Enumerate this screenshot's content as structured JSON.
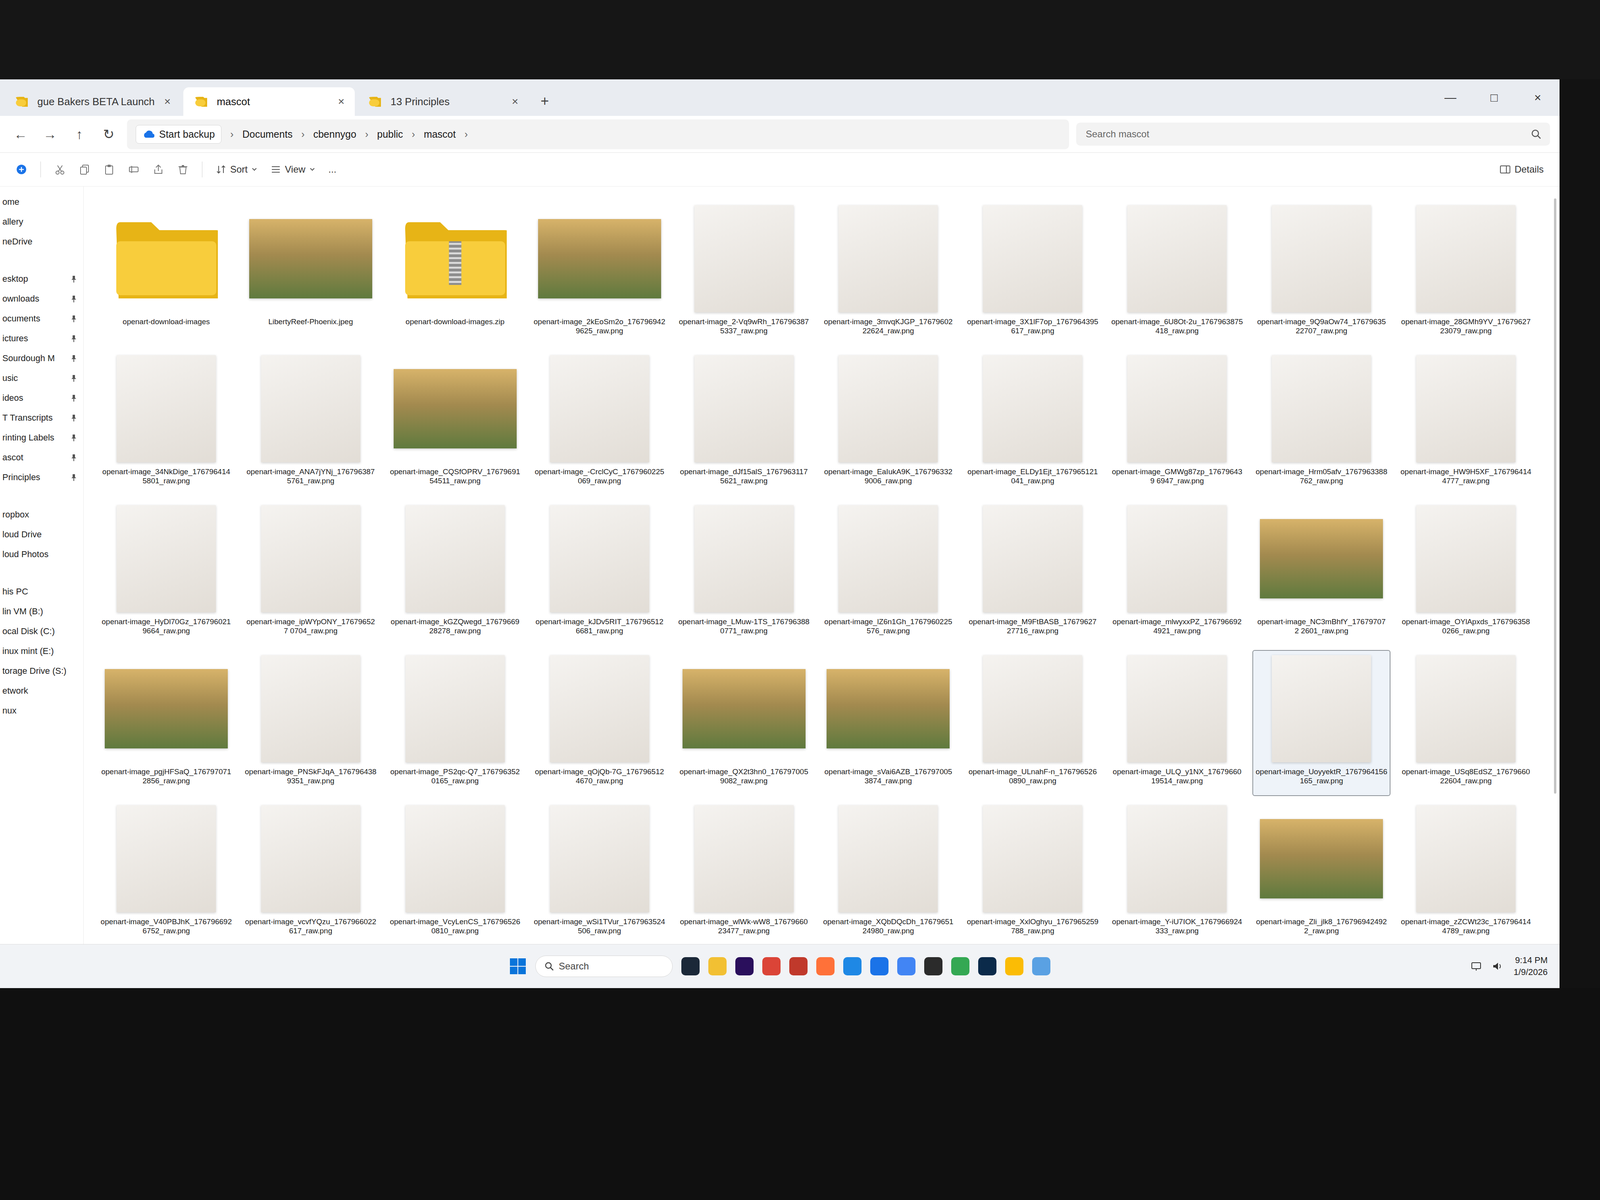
{
  "window": {
    "controls": [
      "—",
      "□",
      "×"
    ]
  },
  "tabs": [
    {
      "label": "gue Bakers BETA Launch",
      "selected": false,
      "close": "×"
    },
    {
      "label": "mascot",
      "selected": true,
      "close": "×"
    },
    {
      "label": "13 Principles",
      "selected": false,
      "close": "×"
    }
  ],
  "new_tab": "+",
  "nav": [
    "←",
    "→",
    "↑",
    "↻"
  ],
  "address": {
    "backup": "Start backup",
    "separator": "›",
    "crumbs": [
      "Documents",
      "cbennygo",
      "public",
      "mascot"
    ]
  },
  "search": {
    "placeholder": "Search mascot"
  },
  "toolbar": {
    "sort": "Sort",
    "view": "View",
    "more": "...",
    "details": "Details"
  },
  "sidebar": {
    "items": [
      {
        "label": "ome",
        "pinned": false
      },
      {
        "label": "allery",
        "pinned": false
      },
      {
        "label": "neDrive",
        "pinned": false
      },
      {
        "label": "esktop",
        "pinned": true
      },
      {
        "label": "ownloads",
        "pinned": true
      },
      {
        "label": "ocuments",
        "pinned": true
      },
      {
        "label": "ictures",
        "pinned": true
      },
      {
        "label": "Sourdough M",
        "pinned": true
      },
      {
        "label": "usic",
        "pinned": true
      },
      {
        "label": "ideos",
        "pinned": true
      },
      {
        "label": "T Transcripts",
        "pinned": true
      },
      {
        "label": "rinting Labels",
        "pinned": true
      },
      {
        "label": "ascot",
        "pinned": true
      },
      {
        "label": "Principles",
        "pinned": true
      },
      {
        "label": "ropbox",
        "pinned": false
      },
      {
        "label": "loud Drive",
        "pinned": false
      },
      {
        "label": "loud Photos",
        "pinned": false
      },
      {
        "label": "his PC",
        "pinned": false
      },
      {
        "label": "lin VM (B:)",
        "pinned": false
      },
      {
        "label": "ocal Disk (C:)",
        "pinned": false
      },
      {
        "label": "inux mint (E:)",
        "pinned": false
      },
      {
        "label": "torage Drive (S:)",
        "pinned": false
      },
      {
        "label": "etwork",
        "pinned": false
      },
      {
        "label": "nux",
        "pinned": false
      }
    ]
  },
  "files": [
    {
      "name": "openart-download-images",
      "kind": "folder",
      "selected": false
    },
    {
      "name": "LibertyReef-Phoenix.jpeg",
      "kind": "scene",
      "selected": false
    },
    {
      "name": "openart-download-images.zip",
      "kind": "zip",
      "selected": false
    },
    {
      "name": "openart-image_2kEoSm2o_1767969429625_raw.png",
      "kind": "scene",
      "selected": false
    },
    {
      "name": "openart-image_2-Vq9wRh_1767963875337_raw.png",
      "kind": "image",
      "selected": false
    },
    {
      "name": "openart-image_3mvqKJGP_1767960222624_raw.png",
      "kind": "image",
      "selected": false
    },
    {
      "name": "openart-image_3X1lF7op_1767964395617_raw.png",
      "kind": "image",
      "selected": false
    },
    {
      "name": "openart-image_6U8Ot-2u_1767963875418_raw.png",
      "kind": "image",
      "selected": false
    },
    {
      "name": "openart-image_9Q9aOw74_1767963522707_raw.png",
      "kind": "image",
      "selected": false
    },
    {
      "name": "openart-image_28GMh9YV_1767962723079_raw.png",
      "kind": "image",
      "selected": false
    },
    {
      "name": "openart-image_34NkDige_1767964145801_raw.png",
      "kind": "image",
      "selected": false
    },
    {
      "name": "openart-image_ANA7jYNj_1767963875761_raw.png",
      "kind": "image",
      "selected": false
    },
    {
      "name": "openart-image_CQSfOPRV_1767969154511_raw.png",
      "kind": "scene",
      "selected": false
    },
    {
      "name": "openart-image_-CrclCyC_1767960225069_raw.png",
      "kind": "image",
      "selected": false
    },
    {
      "name": "openart-image_dJf15alS_17679631175621_raw.png",
      "kind": "image",
      "selected": false
    },
    {
      "name": "openart-image_EaIukA9K_1767963329006_raw.png",
      "kind": "image",
      "selected": false
    },
    {
      "name": "openart-image_ELDy1Ejt_1767965121041_raw.png",
      "kind": "image",
      "selected": false
    },
    {
      "name": "openart-image_GMWg87zp_176796439 6947_raw.png",
      "kind": "image",
      "selected": false
    },
    {
      "name": "openart-image_Hrm05afv_1767963388762_raw.png",
      "kind": "image",
      "selected": false
    },
    {
      "name": "openart-image_HW9H5XF_1767964144777_raw.png",
      "kind": "image",
      "selected": false
    },
    {
      "name": "openart-image_HyDl70Gz_1767960219664_raw.png",
      "kind": "image",
      "selected": false
    },
    {
      "name": "openart-image_ipWYpONY_176796527 0704_raw.png",
      "kind": "image",
      "selected": false
    },
    {
      "name": "openart-image_kGZQwegd_1767966928278_raw.png",
      "kind": "image",
      "selected": false
    },
    {
      "name": "openart-image_kJDv5RIT_1767965126681_raw.png",
      "kind": "image",
      "selected": false
    },
    {
      "name": "openart-image_LMuw-1TS_1767963880771_raw.png",
      "kind": "image",
      "selected": false
    },
    {
      "name": "openart-image_lZ6n1Gh_1767960225576_raw.png",
      "kind": "image",
      "selected": false
    },
    {
      "name": "openart-image_M9FtBASB_1767962727716_raw.png",
      "kind": "image",
      "selected": false
    },
    {
      "name": "openart-image_mlwyxxPZ_1767966924921_raw.png",
      "kind": "image",
      "selected": false
    },
    {
      "name": "openart-image_NC3mBhfY_176797072 2601_raw.png",
      "kind": "scene",
      "selected": false
    },
    {
      "name": "openart-image_OYlApxds_1767963580266_raw.png",
      "kind": "image",
      "selected": false
    },
    {
      "name": "openart-image_pgjHFSaQ_1767970712856_raw.png",
      "kind": "scene",
      "selected": false
    },
    {
      "name": "openart-image_PNSkFJqA_1767964389351_raw.png",
      "kind": "image",
      "selected": false
    },
    {
      "name": "openart-image_PS2qc-Q7_1767963520165_raw.png",
      "kind": "image",
      "selected": false
    },
    {
      "name": "openart-image_qOjQb-7G_1767965124670_raw.png",
      "kind": "image",
      "selected": false
    },
    {
      "name": "openart-image_QX2t3hn0_1767970059082_raw.png",
      "kind": "scene",
      "selected": false
    },
    {
      "name": "openart-image_sVai6AZB_1767970053874_raw.png",
      "kind": "scene",
      "selected": false
    },
    {
      "name": "openart-image_ULnahF-n_1767965260890_raw.png",
      "kind": "image",
      "selected": false
    },
    {
      "name": "openart-image_ULQ_y1NX_1767966019514_raw.png",
      "kind": "image",
      "selected": false
    },
    {
      "name": "openart-image_UoyyektR_1767964156165_raw.png",
      "kind": "image",
      "selected": true
    },
    {
      "name": "openart-image_USq8EdSZ_1767966022604_raw.png",
      "kind": "image",
      "selected": false
    },
    {
      "name": "openart-image_V40PBJhK_1767966926752_raw.png",
      "kind": "image",
      "selected": false
    },
    {
      "name": "openart-image_vcvfYQzu_1767966022617_raw.png",
      "kind": "image",
      "selected": false
    },
    {
      "name": "openart-image_VcyLenCS_1767965260810_raw.png",
      "kind": "image",
      "selected": false
    },
    {
      "name": "openart-image_wSi1TVur_1767963524506_raw.png",
      "kind": "image",
      "selected": false
    },
    {
      "name": "openart-image_wlWk-wW8_1767966023477_raw.png",
      "kind": "image",
      "selected": false
    },
    {
      "name": "openart-image_XQbDQcDh_1767965124980_raw.png",
      "kind": "image",
      "selected": false
    },
    {
      "name": "openart-image_XxlOghyu_1767965259788_raw.png",
      "kind": "image",
      "selected": false
    },
    {
      "name": "openart-image_Y-iU7IOK_1767966924333_raw.png",
      "kind": "image",
      "selected": false
    },
    {
      "name": "openart-image_Zli_jlk8_1767969424922_raw.png",
      "kind": "scene",
      "selected": false
    },
    {
      "name": "openart-image_zZCWt23c_1767964144789_raw.png",
      "kind": "image",
      "selected": false
    }
  ],
  "taskbar": {
    "search": "Search",
    "time": "9:14 PM",
    "date": "1/9/2026"
  }
}
